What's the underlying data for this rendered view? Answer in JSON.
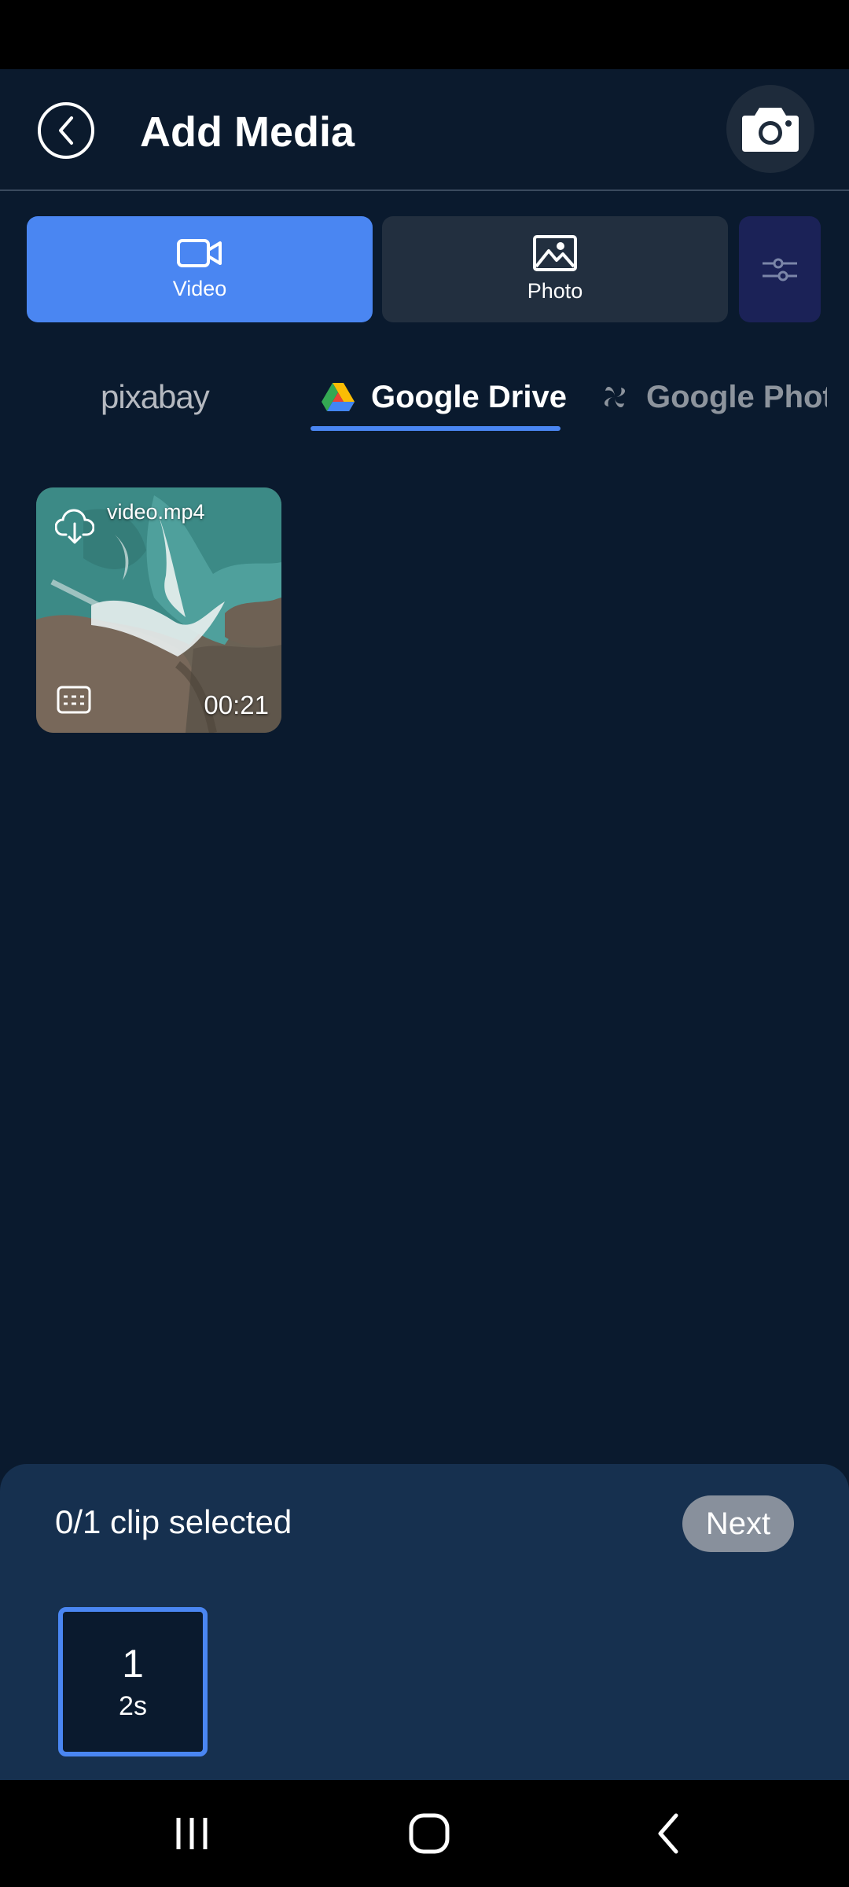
{
  "header": {
    "title": "Add Media",
    "back_icon": "chevron-left-circle-icon",
    "camera_icon": "camera-icon"
  },
  "media_types": [
    {
      "label": "Video",
      "icon": "video-camera-icon",
      "selected": true
    },
    {
      "label": "Photo",
      "icon": "image-icon",
      "selected": false
    }
  ],
  "filter_icon": "sliders-icon",
  "sources": [
    {
      "label": "pixabay",
      "selected": false
    },
    {
      "label": "Google Drive",
      "icon": "google-drive-icon",
      "selected": true
    },
    {
      "label": "Google Photos",
      "icon": "pinwheel-icon",
      "selected": false
    }
  ],
  "media_items": [
    {
      "name": "video.mp4",
      "duration": "00:21",
      "icons": [
        "cloud-download-icon",
        "subtitles-icon"
      ]
    }
  ],
  "selection": {
    "count_text": "0/1 clip selected",
    "next_label": "Next",
    "slots": [
      {
        "index": "1",
        "duration": "2s"
      }
    ]
  },
  "colors": {
    "accent": "#4a86f2",
    "background": "#0a1a2e",
    "panel": "#16304f",
    "next_disabled": "#88909c"
  },
  "nav_icons": [
    "recents-icon",
    "home-icon",
    "back-icon"
  ]
}
